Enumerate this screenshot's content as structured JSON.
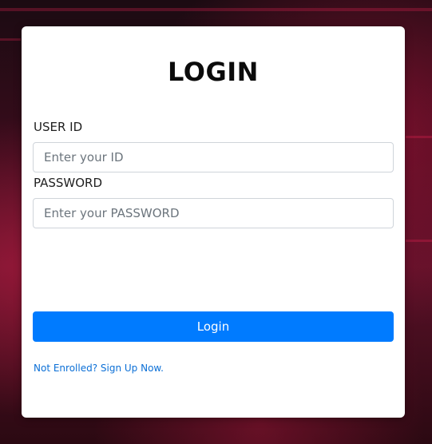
{
  "login": {
    "title": "LOGIN",
    "user_id_label": "USER ID",
    "user_id_placeholder": "Enter your ID",
    "password_label": "PASSWORD",
    "password_placeholder": "Enter your PASSWORD",
    "submit_label": "Login",
    "signup_link": "Not Enrolled? Sign Up Now."
  },
  "colors": {
    "primary_button": "#007bff",
    "link": "#0b6fd6",
    "card_background": "#ffffff"
  }
}
